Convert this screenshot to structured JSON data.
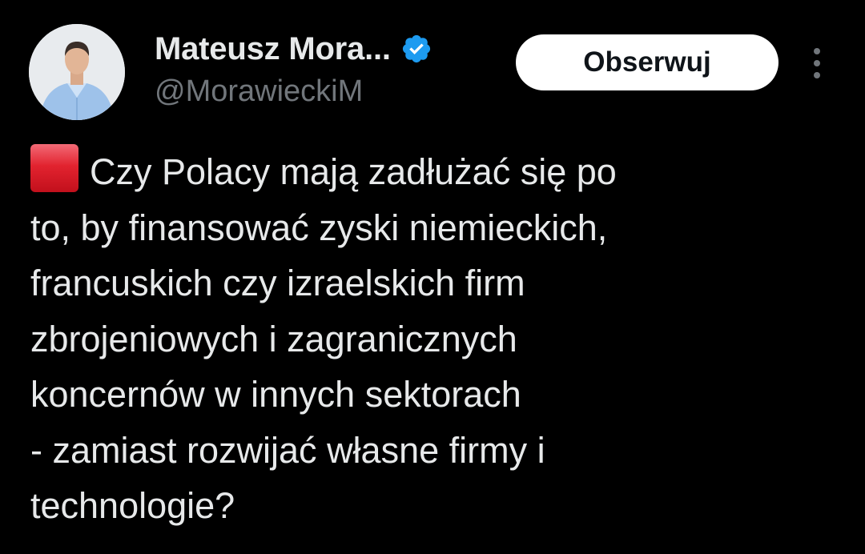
{
  "author": {
    "display_name": "Mateusz Mora...",
    "handle": "@MorawieckiM",
    "verified": true,
    "avatar_icon": "profile-photo"
  },
  "actions": {
    "follow_label": "Obserwuj",
    "more_icon": "vertical-ellipsis-icon"
  },
  "tweet": {
    "emoji": "red-square",
    "lines": [
      "Czy Polacy mają zadłużać się po",
      "to, by finansować zyski niemieckich,",
      "francuskich czy izraelskich firm",
      "zbrojeniowych i zagranicznych",
      "koncernów w innych sektorach",
      "- zamiast rozwijać własne firmy i",
      "technologie?"
    ]
  },
  "colors": {
    "background": "#000000",
    "text_primary": "#e7e9ea",
    "text_secondary": "#71767b",
    "verified_badge": "#1d9bf0",
    "follow_button_bg": "#ffffff",
    "follow_button_text": "#0f1419"
  }
}
